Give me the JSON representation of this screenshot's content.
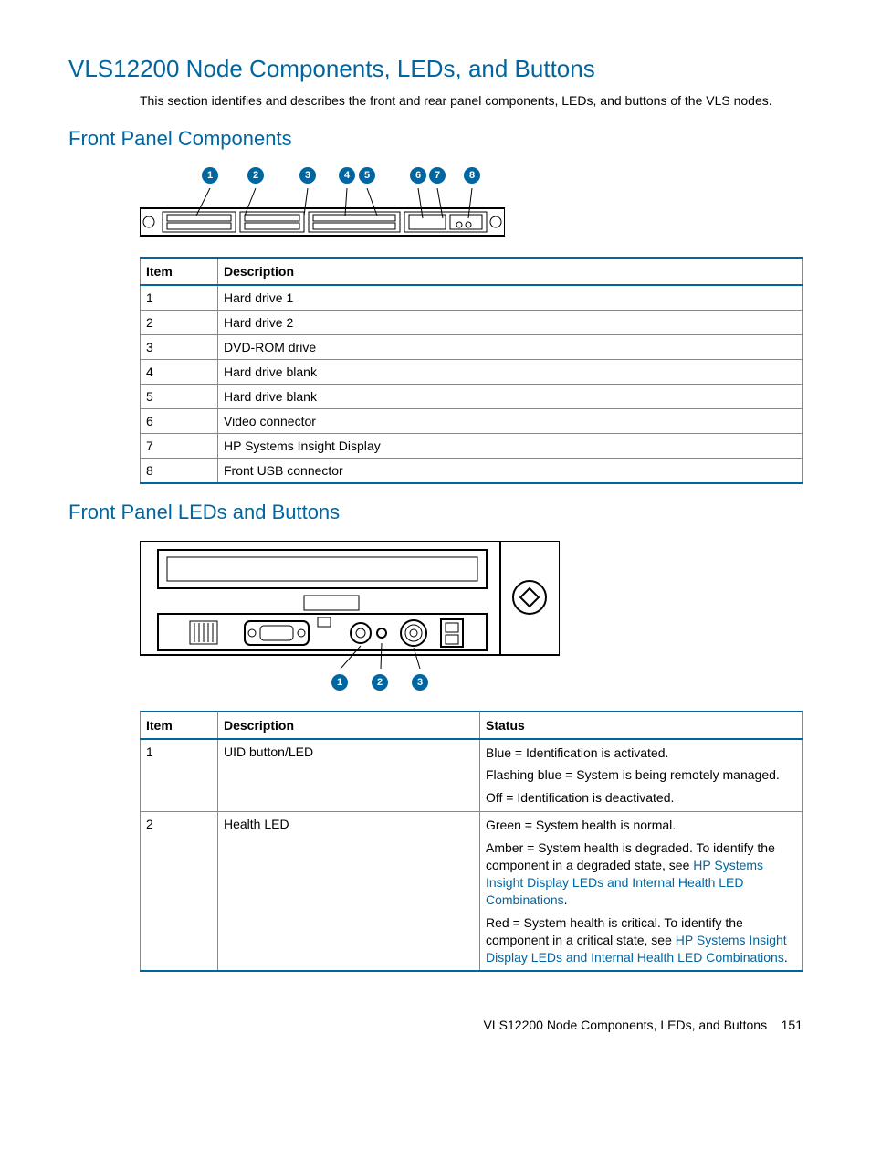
{
  "heading1": "VLS12200 Node Components, LEDs, and Buttons",
  "intro": "This section identifies and describes the front and rear panel components, LEDs, and buttons of the VLS nodes.",
  "heading2a": "Front Panel Components",
  "heading2b": "Front Panel LEDs and Buttons",
  "table1": {
    "headers": {
      "item": "Item",
      "desc": "Description"
    },
    "rows": [
      {
        "item": "1",
        "desc": "Hard drive 1"
      },
      {
        "item": "2",
        "desc": "Hard drive 2"
      },
      {
        "item": "3",
        "desc": "DVD-ROM drive"
      },
      {
        "item": "4",
        "desc": "Hard drive blank"
      },
      {
        "item": "5",
        "desc": "Hard drive blank"
      },
      {
        "item": "6",
        "desc": "Video connector"
      },
      {
        "item": "7",
        "desc": "HP Systems Insight Display"
      },
      {
        "item": "8",
        "desc": "Front USB connector"
      }
    ]
  },
  "table2": {
    "headers": {
      "item": "Item",
      "desc": "Description",
      "status": "Status"
    },
    "rows": [
      {
        "item": "1",
        "desc": "UID button/LED",
        "status": [
          {
            "text": "Blue = Identification is activated."
          },
          {
            "text": "Flashing blue = System is being remotely managed."
          },
          {
            "text": "Off = Identification is deactivated."
          }
        ]
      },
      {
        "item": "2",
        "desc": "Health LED",
        "status": [
          {
            "text": "Green = System health is normal."
          },
          {
            "pre": "Amber = System health is degraded. To identify the component in a degraded state, see ",
            "link": "HP Systems Insight Display LEDs and Internal Health LED Combinations",
            "post": "."
          },
          {
            "pre": "Red = System health is critical. To identify the component in a critical state, see ",
            "link": "HP Systems Insight Display LEDs and Internal Health LED Combinations",
            "post": "."
          }
        ]
      }
    ]
  },
  "callout_labels": [
    "1",
    "2",
    "3",
    "4",
    "5",
    "6",
    "7",
    "8"
  ],
  "callout_labels2": [
    "1",
    "2",
    "3"
  ],
  "footer": {
    "title": "VLS12200 Node Components, LEDs, and Buttons",
    "page": "151"
  }
}
